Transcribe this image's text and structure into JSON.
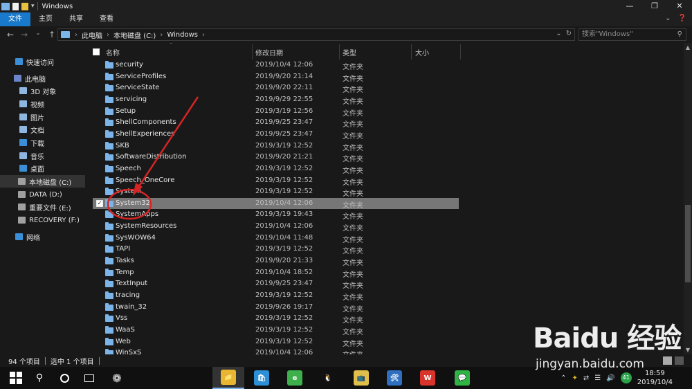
{
  "window": {
    "title": "Windows",
    "controls": [
      "—",
      "❐",
      "✕"
    ]
  },
  "ribbon": {
    "tabs": [
      "文件",
      "主页",
      "共享",
      "查看"
    ],
    "active_index": 0
  },
  "address": {
    "crumbs": [
      "此电脑",
      "本地磁盘 (C:)",
      "Windows"
    ],
    "search_placeholder": "搜索\"Windows\""
  },
  "navpane": {
    "items": [
      {
        "label": "快速访问",
        "icon": "star-icon",
        "color": "#3a8fd6"
      },
      {
        "label": "此电脑",
        "icon": "computer-icon",
        "color": "#6a86c8"
      },
      {
        "label": "3D 对象",
        "icon": "cube-icon",
        "color": "#8fb6e0"
      },
      {
        "label": "视频",
        "icon": "video-icon",
        "color": "#8fb6e0"
      },
      {
        "label": "图片",
        "icon": "picture-icon",
        "color": "#8fb6e0"
      },
      {
        "label": "文档",
        "icon": "document-icon",
        "color": "#8fb6e0"
      },
      {
        "label": "下载",
        "icon": "download-icon",
        "color": "#3a8fd6"
      },
      {
        "label": "音乐",
        "icon": "music-icon",
        "color": "#8fb6e0"
      },
      {
        "label": "桌面",
        "icon": "desktop-icon",
        "color": "#3a8fd6"
      },
      {
        "label": "本地磁盘 (C:)",
        "icon": "drive-icon",
        "color": "#a0a0a0"
      },
      {
        "label": "DATA (D:)",
        "icon": "drive-icon",
        "color": "#a0a0a0"
      },
      {
        "label": "重要文件 (E:)",
        "icon": "drive-icon",
        "color": "#a0a0a0"
      },
      {
        "label": "RECOVERY (F:)",
        "icon": "drive-icon",
        "color": "#a0a0a0"
      },
      {
        "label": "网络",
        "icon": "network-icon",
        "color": "#3a8fd6"
      }
    ],
    "selected_index": 9
  },
  "columns": {
    "name": "名称",
    "date": "修改日期",
    "type": "类型",
    "size": "大小"
  },
  "files": [
    {
      "name": "security",
      "date": "2019/10/4 12:06",
      "type": "文件夹"
    },
    {
      "name": "ServiceProfiles",
      "date": "2019/9/20 21:14",
      "type": "文件夹"
    },
    {
      "name": "ServiceState",
      "date": "2019/9/20 22:11",
      "type": "文件夹"
    },
    {
      "name": "servicing",
      "date": "2019/9/29 22:55",
      "type": "文件夹"
    },
    {
      "name": "Setup",
      "date": "2019/3/19 12:56",
      "type": "文件夹"
    },
    {
      "name": "ShellComponents",
      "date": "2019/9/25 23:47",
      "type": "文件夹"
    },
    {
      "name": "ShellExperiences",
      "date": "2019/9/25 23:47",
      "type": "文件夹"
    },
    {
      "name": "SKB",
      "date": "2019/3/19 12:52",
      "type": "文件夹"
    },
    {
      "name": "SoftwareDistribution",
      "date": "2019/9/20 21:21",
      "type": "文件夹"
    },
    {
      "name": "Speech",
      "date": "2019/3/19 12:52",
      "type": "文件夹"
    },
    {
      "name": "Speech_OneCore",
      "date": "2019/3/19 12:52",
      "type": "文件夹"
    },
    {
      "name": "System",
      "date": "2019/3/19 12:52",
      "type": "文件夹"
    },
    {
      "name": "System32",
      "date": "2019/10/4 12:06",
      "type": "文件夹"
    },
    {
      "name": "SystemApps",
      "date": "2019/3/19 19:43",
      "type": "文件夹"
    },
    {
      "name": "SystemResources",
      "date": "2019/10/4 12:06",
      "type": "文件夹"
    },
    {
      "name": "SysWOW64",
      "date": "2019/10/4 11:48",
      "type": "文件夹"
    },
    {
      "name": "TAPI",
      "date": "2019/3/19 12:52",
      "type": "文件夹"
    },
    {
      "name": "Tasks",
      "date": "2019/9/20 21:33",
      "type": "文件夹"
    },
    {
      "name": "Temp",
      "date": "2019/10/4 18:52",
      "type": "文件夹"
    },
    {
      "name": "TextInput",
      "date": "2019/9/25 23:47",
      "type": "文件夹"
    },
    {
      "name": "tracing",
      "date": "2019/3/19 12:52",
      "type": "文件夹"
    },
    {
      "name": "twain_32",
      "date": "2019/9/26 19:17",
      "type": "文件夹"
    },
    {
      "name": "Vss",
      "date": "2019/3/19 12:52",
      "type": "文件夹"
    },
    {
      "name": "WaaS",
      "date": "2019/3/19 12:52",
      "type": "文件夹"
    },
    {
      "name": "Web",
      "date": "2019/3/19 12:52",
      "type": "文件夹"
    },
    {
      "name": "WinSxS",
      "date": "2019/10/4 12:06",
      "type": "文件夹"
    }
  ],
  "selected_file_index": 12,
  "status": {
    "count": "94 个项目",
    "selected": "选中 1 个项目"
  },
  "taskbar": {
    "apps": [
      {
        "icon": "file-explorer-icon",
        "color": "#e8b630",
        "glyph": "📁",
        "active": true
      },
      {
        "icon": "store-icon",
        "color": "#2d8fd6",
        "glyph": "🛍",
        "active": false
      },
      {
        "icon": "browser-icon",
        "color": "#3db04b",
        "glyph": "e",
        "active": false
      },
      {
        "icon": "qq-icon",
        "color": "#111111",
        "glyph": "🐧",
        "active": false
      },
      {
        "icon": "media-icon",
        "color": "#e0c04a",
        "glyph": "📺",
        "active": false
      },
      {
        "icon": "toolbox-icon",
        "color": "#2f6fc0",
        "glyph": "🛠",
        "active": false
      },
      {
        "icon": "wps-icon",
        "color": "#d9342b",
        "glyph": "W",
        "active": false
      },
      {
        "icon": "wechat-icon",
        "color": "#2fb344",
        "glyph": "💬",
        "active": false
      }
    ],
    "badge": "41",
    "time": "18:59",
    "date": "2019/10/4"
  },
  "watermark": {
    "logo": "Baidu 经验",
    "url": "jingyan.baidu.com"
  },
  "annotation_color": "#d62424"
}
